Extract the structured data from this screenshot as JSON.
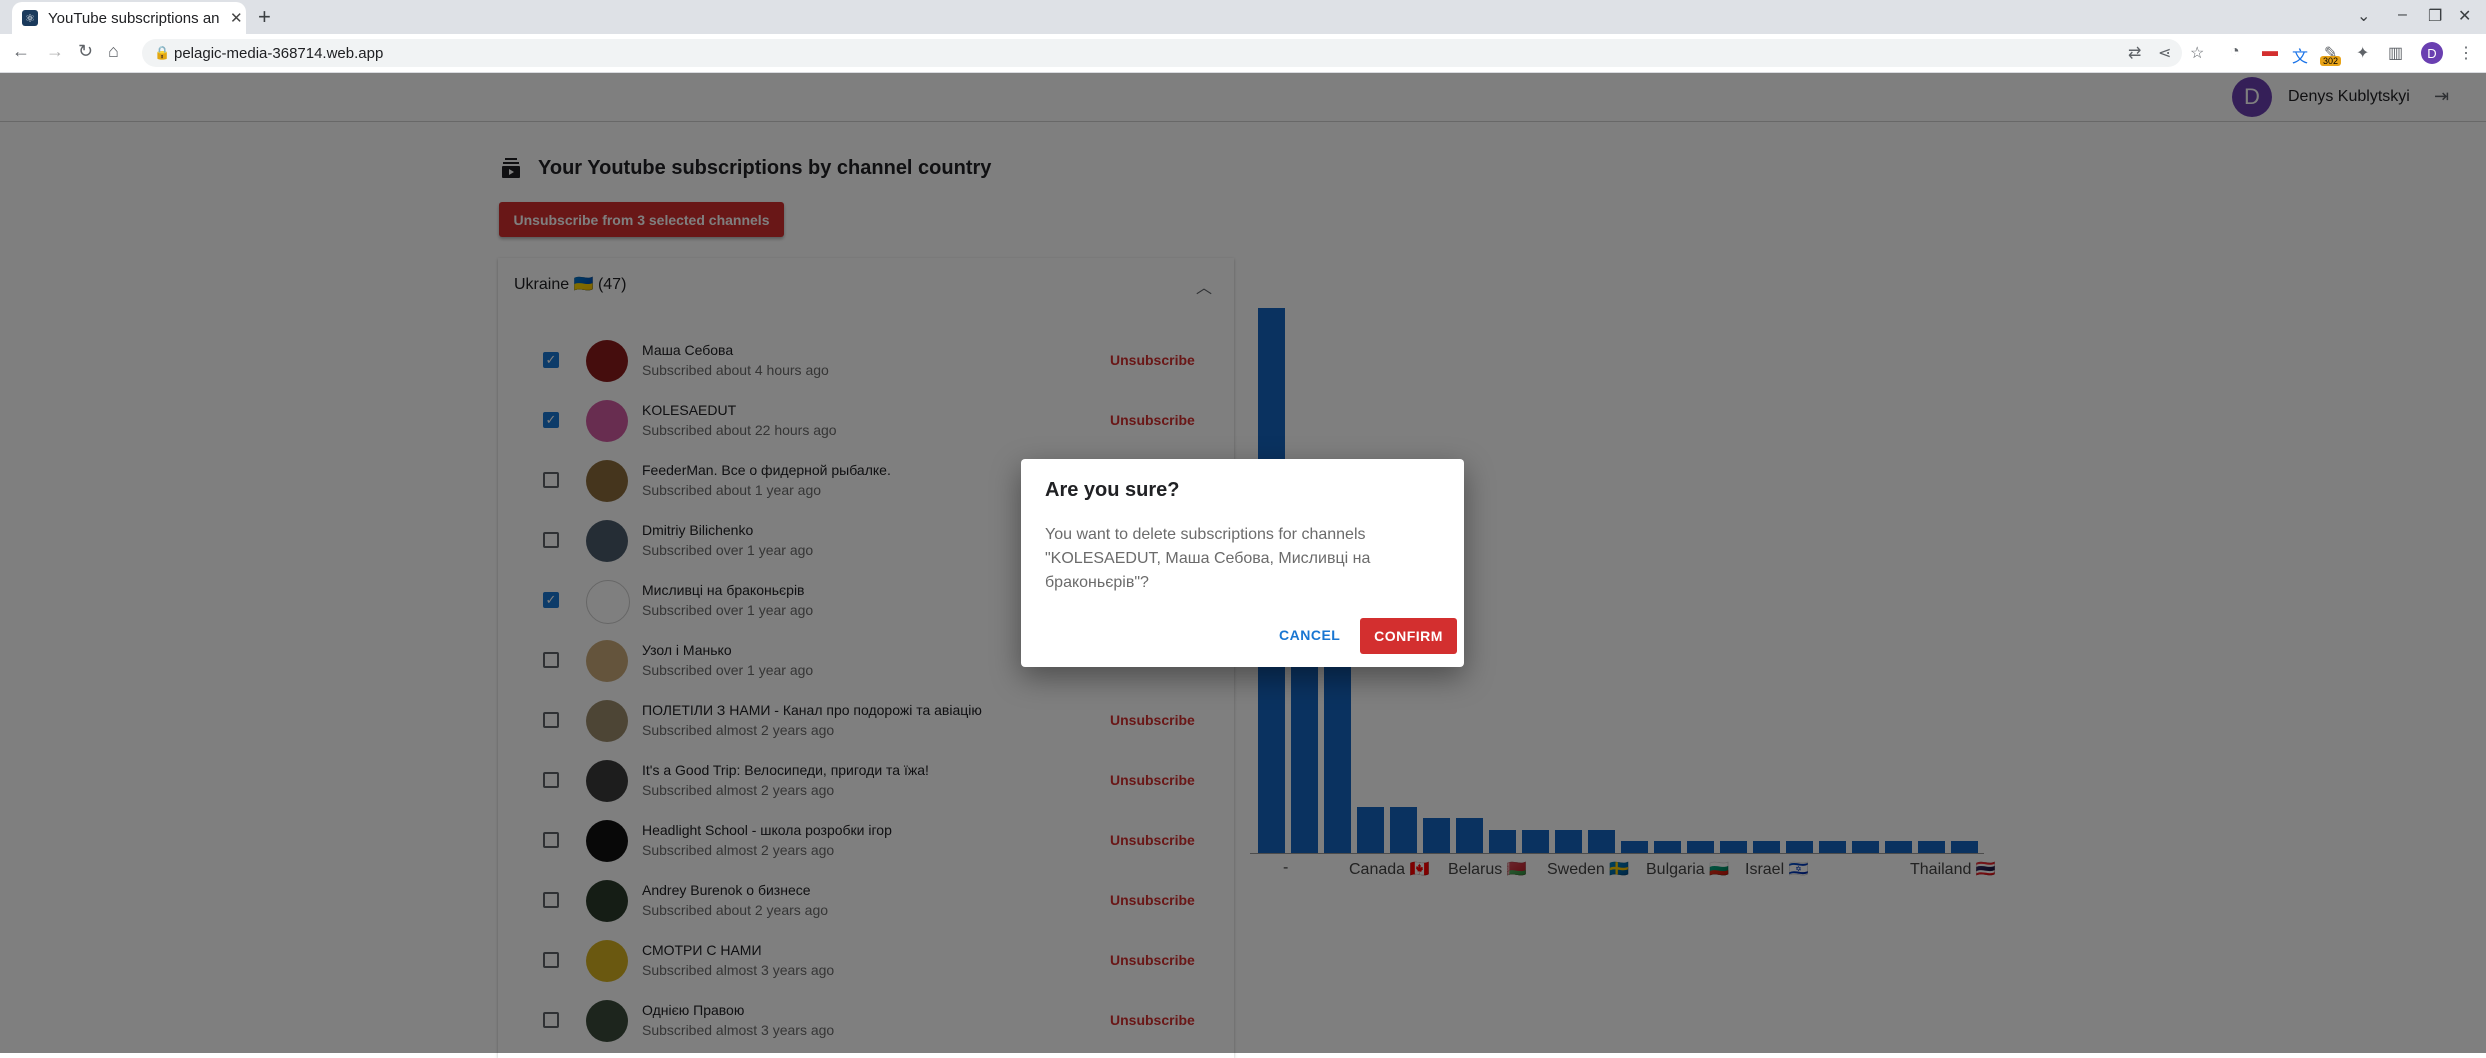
{
  "browser": {
    "tab_title": "YouTube subscriptions an",
    "url": "pelagic-media-368714.web.app",
    "ext_badge": "302",
    "profile_initial": "D"
  },
  "header": {
    "avatar_initial": "D",
    "user_name": "Denys Kublytskyi"
  },
  "page": {
    "title": "Your Youtube subscriptions by channel country",
    "unsubscribe_selected_label": "Unsubscribe from 3 selected channels"
  },
  "panel": {
    "title": "Ukraine 🇺🇦 (47)",
    "unsubscribe_label": "Unsubscribe",
    "channels": [
      {
        "name": "Маша Себова",
        "subscribed": "Subscribed about 4 hours ago",
        "checked": true,
        "avatar_color": "#8b1a1a"
      },
      {
        "name": "KOLESAEDUT",
        "subscribed": "Subscribed about 22 hours ago",
        "checked": true,
        "avatar_color": "#d05aa0"
      },
      {
        "name": "FeederMan. Все о фидерной рыбалке.",
        "subscribed": "Subscribed about 1 year ago",
        "checked": false,
        "avatar_color": "#8a6a3a"
      },
      {
        "name": "Dmitriy Bilichenko",
        "subscribed": "Subscribed over 1 year ago",
        "checked": false,
        "avatar_color": "#4a5a6a"
      },
      {
        "name": "Мисливці на браконьєрів",
        "subscribed": "Subscribed over 1 year ago",
        "checked": true,
        "avatar_color": "#ffffff"
      },
      {
        "name": "Узол і Манько",
        "subscribed": "Subscribed over 1 year ago",
        "checked": false,
        "avatar_color": "#c8a878"
      },
      {
        "name": "ПОЛЕТІЛИ З НАМИ - Канал про подорожі та авіацію",
        "subscribed": "Subscribed almost 2 years ago",
        "checked": false,
        "avatar_color": "#9a8a6a"
      },
      {
        "name": "It's a Good Trip: Велосипеди, пригоди та їжа!",
        "subscribed": "Subscribed almost 2 years ago",
        "checked": false,
        "avatar_color": "#3a3a3a"
      },
      {
        "name": "Headlight School - школа розробки ігор",
        "subscribed": "Subscribed almost 2 years ago",
        "checked": false,
        "avatar_color": "#111111"
      },
      {
        "name": "Andrey Burenok о бизнесе",
        "subscribed": "Subscribed about 2 years ago",
        "checked": false,
        "avatar_color": "#2a3a2a"
      },
      {
        "name": "СМОТРИ С НАМИ",
        "subscribed": "Subscribed almost 3 years ago",
        "checked": false,
        "avatar_color": "#d4b020"
      },
      {
        "name": "Однією Правою",
        "subscribed": "Subscribed almost 3 years ago",
        "checked": false,
        "avatar_color": "#3a4a3a"
      }
    ]
  },
  "chart_data": {
    "type": "bar",
    "categories": [
      "-",
      "Canada 🇨🇦",
      "Belarus 🇧🇾",
      "Sweden 🇸🇪",
      "Bulgaria 🇧🇬",
      "Israel 🇮🇱",
      "Thailand 🇹🇭"
    ],
    "values": [
      47,
      16,
      16,
      4,
      4,
      3,
      3,
      2,
      2,
      2,
      2,
      1,
      1,
      1,
      1,
      1,
      1,
      1,
      1,
      1,
      1,
      1
    ],
    "color": "#1565c0"
  },
  "dialog": {
    "title": "Are you sure?",
    "message": "You want to delete subscriptions for channels \"KOLESAEDUT, Маша Себова, Мисливці на браконьєрів\"?",
    "cancel_label": "CANCEL",
    "confirm_label": "CONFIRM"
  }
}
